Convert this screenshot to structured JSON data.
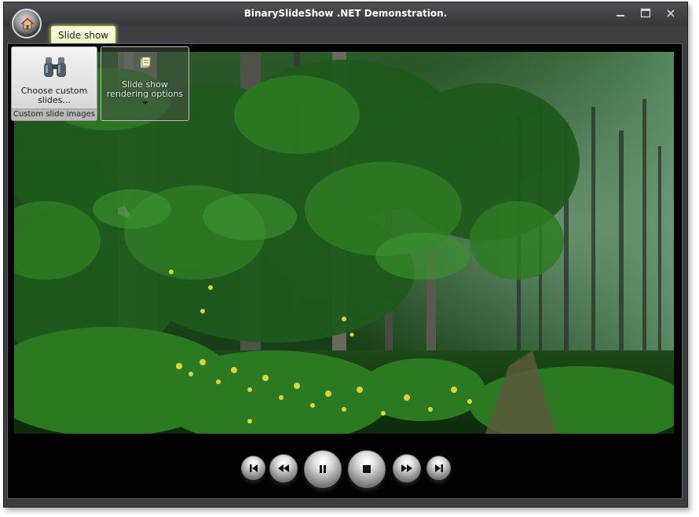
{
  "window": {
    "title": "BinarySlideShow .NET Demonstration."
  },
  "icons": {
    "app_orb": "home-icon",
    "minimize": "minimize-icon",
    "maximize": "maximize-icon",
    "close": "close-icon"
  },
  "ribbon": {
    "tabs": [
      {
        "label": "Slide show",
        "selected": true
      }
    ],
    "groups": {
      "custom_slides": {
        "button_label": "Choose custom slides...",
        "button_icon": "binoculars-icon",
        "caption": "Custom slide images"
      },
      "rendering": {
        "button_label": "Slide show rendering options",
        "button_icon": "options-icon",
        "has_dropdown": true
      }
    }
  },
  "slide": {
    "subject": "forest-photo"
  },
  "player": {
    "buttons": [
      {
        "name": "skip-to-start-button",
        "icon": "skip-start-icon"
      },
      {
        "name": "rewind-button",
        "icon": "rewind-icon"
      },
      {
        "name": "pause-button",
        "icon": "pause-icon"
      },
      {
        "name": "stop-button",
        "icon": "stop-icon"
      },
      {
        "name": "fast-forward-button",
        "icon": "fast-forward-icon"
      },
      {
        "name": "skip-to-end-button",
        "icon": "skip-end-icon"
      }
    ]
  },
  "colors": {
    "window_chrome": "#3b3d40",
    "content_bg": "#020202",
    "tab_highlight": "#f1f3c8",
    "ribbon_button_bg": "#e6e6e6"
  }
}
